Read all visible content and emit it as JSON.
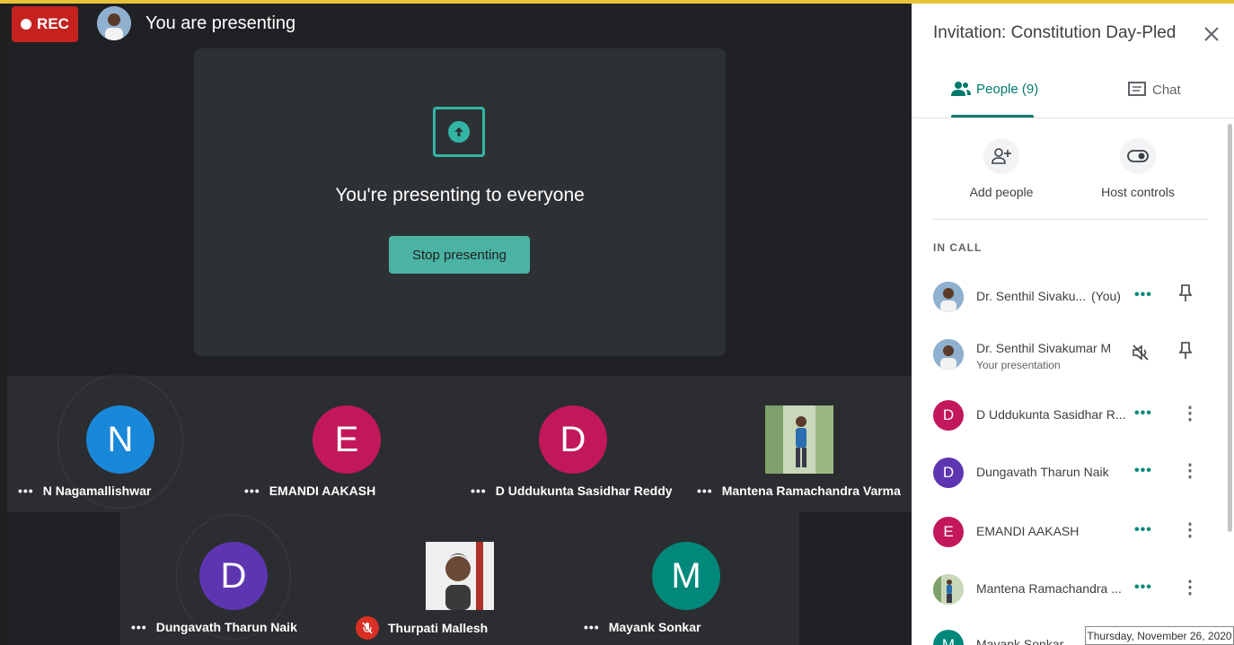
{
  "recording": {
    "label": "REC"
  },
  "presenter_bar": {
    "title": "You are presenting"
  },
  "presenting_card": {
    "heading": "You're presenting to everyone",
    "stop_label": "Stop presenting"
  },
  "tiles": [
    {
      "initial": "N",
      "name": "N Nagamallishwar",
      "color": "#1a88d9"
    },
    {
      "initial": "E",
      "name": "EMANDI AAKASH",
      "color": "#c2185b"
    },
    {
      "initial": "D",
      "name": "D Uddukunta Sasidhar Reddy",
      "color": "#c2185b"
    },
    {
      "initial": "",
      "name": "Mantena Ramachandra Varma",
      "color": "#6b8f5a"
    },
    {
      "initial": "D",
      "name": "Dungavath Tharun Naik",
      "color": "#5e35b1"
    },
    {
      "initial": "",
      "name": "Thurpati Mallesh",
      "color": "#8a7a70"
    },
    {
      "initial": "M",
      "name": "Mayank Sonkar",
      "color": "#00897b"
    }
  ],
  "panel": {
    "title": "Invitation: Constitution Day-Pled...",
    "tabs": {
      "people": "People (9)",
      "chat": "Chat"
    },
    "actions": {
      "add_people": "Add people",
      "host_controls": "Host controls"
    },
    "section_label": "IN CALL",
    "people": [
      {
        "initial": "",
        "name": "Dr. Senthil Sivaku...",
        "suffix": "(You)",
        "sub": "",
        "color": "#7a9cc0"
      },
      {
        "initial": "",
        "name": "Dr. Senthil Sivakumar M",
        "suffix": "",
        "sub": "Your presentation",
        "color": "#7a9cc0"
      },
      {
        "initial": "D",
        "name": "D Uddukunta Sasidhar R...",
        "suffix": "",
        "sub": "",
        "color": "#c2185b"
      },
      {
        "initial": "D",
        "name": "Dungavath Tharun Naik",
        "suffix": "",
        "sub": "",
        "color": "#5e35b1"
      },
      {
        "initial": "E",
        "name": "EMANDI AAKASH",
        "suffix": "",
        "sub": "",
        "color": "#c2185b"
      },
      {
        "initial": "",
        "name": "Mantena Ramachandra ...",
        "suffix": "",
        "sub": "",
        "color": "#6b8f5a"
      },
      {
        "initial": "M",
        "name": "Mayank Sonkar",
        "suffix": "",
        "sub": "",
        "color": "#00897b"
      }
    ]
  },
  "taskbar": {
    "date": "Thursday, November 26, 2020"
  }
}
